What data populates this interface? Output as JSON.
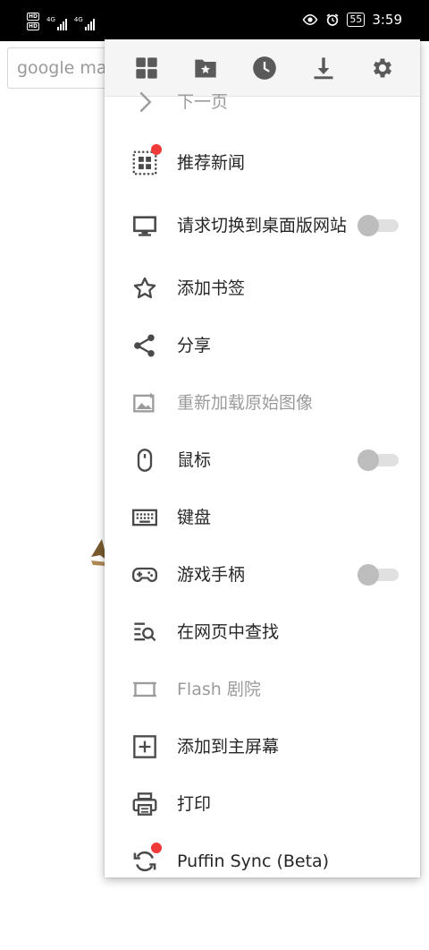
{
  "status_bar": {
    "network_badges": [
      "HD",
      "HD"
    ],
    "signal_labels": [
      "4G",
      "4G"
    ],
    "battery": "55",
    "time": "3:59"
  },
  "page": {
    "search_text": "google ma"
  },
  "menu": {
    "toolbar": [
      {
        "name": "dashboard-button",
        "icon": "dashboard-icon"
      },
      {
        "name": "bookmarks-folder-button",
        "icon": "folder-star-icon"
      },
      {
        "name": "history-button",
        "icon": "clock-icon"
      },
      {
        "name": "downloads-button",
        "icon": "download-icon"
      },
      {
        "name": "settings-button",
        "icon": "gear-icon"
      }
    ],
    "items": [
      {
        "label": "下一页",
        "icon": "chevron-right-icon",
        "disabled": true
      },
      {
        "label": "推荐新闻",
        "icon": "news-grid-icon",
        "badge": true
      },
      {
        "label": "请求切换到桌面版网站",
        "icon": "desktop-icon",
        "toggle": false
      },
      {
        "label": "添加书签",
        "icon": "star-icon"
      },
      {
        "label": "分享",
        "icon": "share-icon"
      },
      {
        "label": "重新加载原始图像",
        "icon": "image-reload-icon",
        "disabled": true
      },
      {
        "label": "鼠标",
        "icon": "mouse-icon",
        "toggle": false
      },
      {
        "label": "键盘",
        "icon": "keyboard-icon"
      },
      {
        "label": "游戏手柄",
        "icon": "gamepad-icon",
        "toggle": false
      },
      {
        "label": "在网页中查找",
        "icon": "find-in-page-icon"
      },
      {
        "label": "Flash 剧院",
        "icon": "flash-theater-icon",
        "disabled": true
      },
      {
        "label": "添加到主屏幕",
        "icon": "add-box-icon"
      },
      {
        "label": "打印",
        "icon": "printer-icon"
      },
      {
        "label": "Puffin Sync (Beta)",
        "icon": "sync-icon",
        "badge": true
      }
    ]
  },
  "colors": {
    "icon": "#5a5a5a",
    "text": "#262626",
    "disabled_text": "#9b9b9b",
    "badge": "#f03a3a",
    "toolbar_bg": "#f5f5f5"
  }
}
